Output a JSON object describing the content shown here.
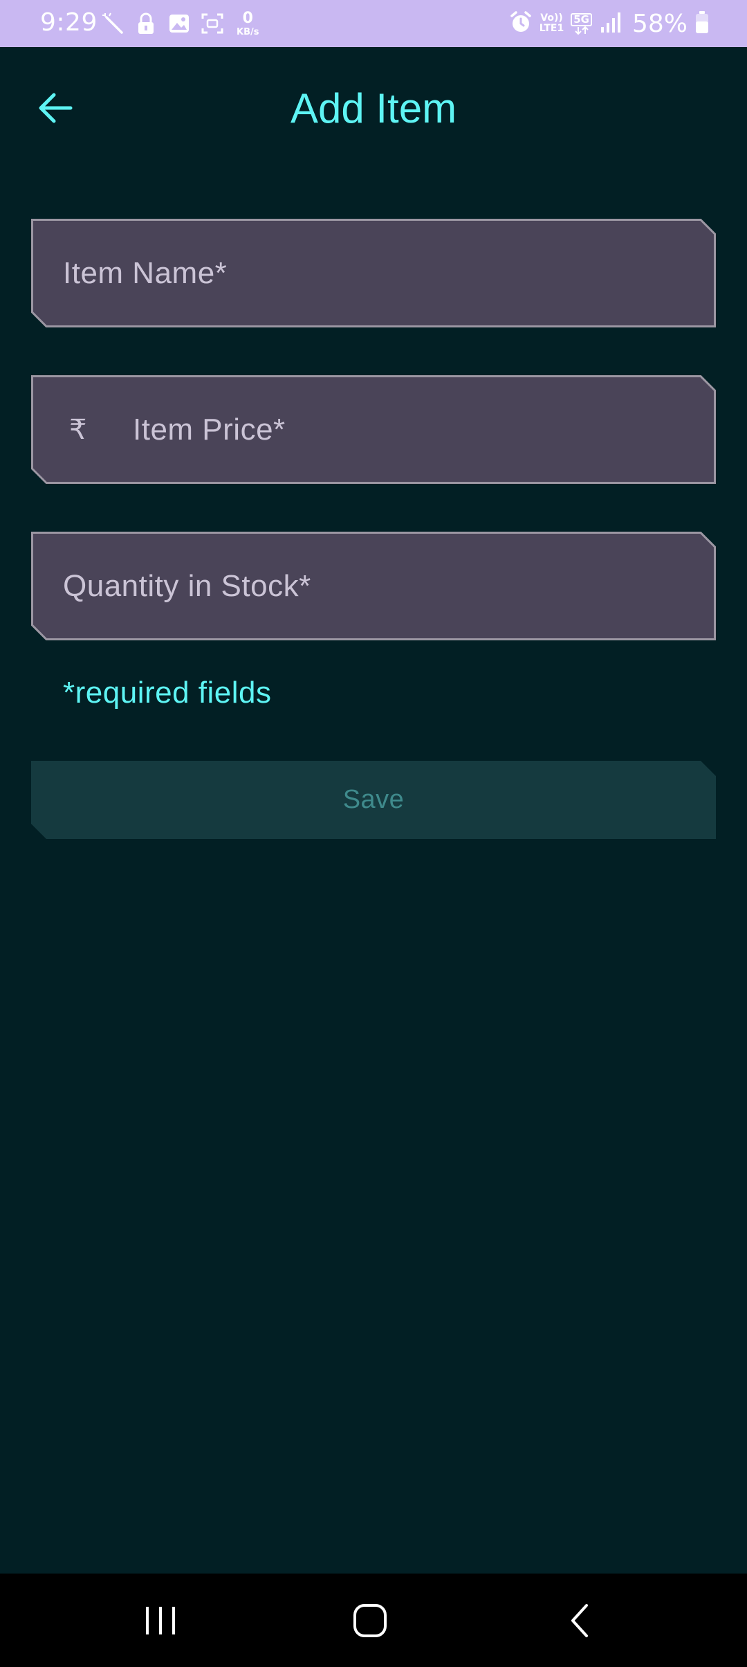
{
  "status_bar": {
    "time": "9:29",
    "data_speed_value": "0",
    "data_speed_unit": "KB/s",
    "volte_top": "Vo))",
    "volte_bottom": "LTE1",
    "network_type": "5G",
    "battery_percent": "58%",
    "icons": [
      "magic-wand-icon",
      "lock-icon",
      "gallery-icon",
      "screenshot-icon",
      "alarm-icon",
      "signal-icon",
      "battery-icon"
    ]
  },
  "header": {
    "title": "Add Item",
    "back_icon": "arrow-left-icon"
  },
  "form": {
    "item_name": {
      "value": "",
      "placeholder": "Item Name*"
    },
    "item_price": {
      "value": "",
      "placeholder": "Item Price*",
      "currency_symbol": "₹"
    },
    "quantity": {
      "value": "",
      "placeholder": "Quantity in Stock*"
    },
    "required_note": "*required fields",
    "save_label": "Save"
  },
  "nav_bar": {
    "icons": [
      "recent-apps-icon",
      "home-icon",
      "back-icon"
    ]
  },
  "colors": {
    "background": "#021f24",
    "accent": "#5ef4f4",
    "field_fill": "#4a4458",
    "field_border": "#9c97a3",
    "button_fill": "#153a3f",
    "button_text": "#3f8a8c",
    "status_bar": "#c9b8f2"
  }
}
